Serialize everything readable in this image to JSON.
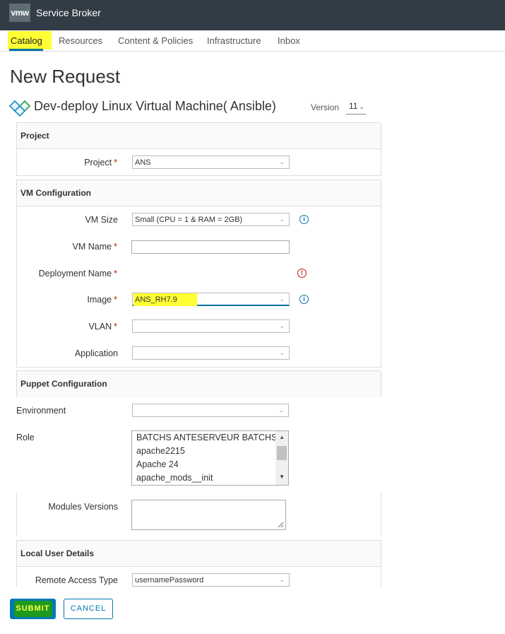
{
  "app": {
    "logo": "vmw",
    "title": "Service Broker"
  },
  "nav": {
    "tabs": [
      "Catalog",
      "Resources",
      "Content & Policies",
      "Infrastructure",
      "Inbox"
    ],
    "active": "Catalog"
  },
  "page": {
    "title": "New Request"
  },
  "item": {
    "title": "Dev-deploy Linux Virtual Machine( Ansible)",
    "version_label": "Version",
    "version_value": "11"
  },
  "sections": {
    "project": "Project",
    "vm_config": "VM Configuration",
    "puppet_config": "Puppet Configuration",
    "local_user": "Local User Details"
  },
  "fields": {
    "project": {
      "label": "Project",
      "required": "*",
      "value": "ANS"
    },
    "vm_size": {
      "label": "VM Size",
      "value": "Small (CPU = 1 & RAM = 2GB)"
    },
    "vm_name": {
      "label": "VM Name",
      "required": "*",
      "value": ""
    },
    "deployment_name": {
      "label": "Deployment Name",
      "required": "*"
    },
    "image": {
      "label": "Image",
      "required": "*",
      "value": "ANS_RH7.9"
    },
    "vlan": {
      "label": "VLAN",
      "required": "*",
      "value": ""
    },
    "application": {
      "label": "Application",
      "value": ""
    },
    "environment": {
      "label": "Environment",
      "value": ""
    },
    "role": {
      "label": "Role",
      "options": [
        "BATCHS ANTESERVEUR BATCHS",
        "apache2215",
        "Apache 24",
        "apache_mods__init"
      ]
    },
    "modules_versions": {
      "label": "Modules Versions",
      "value": ""
    },
    "remote_access_type": {
      "label": "Remote Access Type",
      "value": "usernamePassword"
    }
  },
  "buttons": {
    "submit": "SUBMIT",
    "cancel": "CANCEL"
  },
  "colors": {
    "topbar": "#313c46",
    "accent": "#0072a3",
    "error": "#c21d00",
    "highlight": "#ffff33"
  }
}
